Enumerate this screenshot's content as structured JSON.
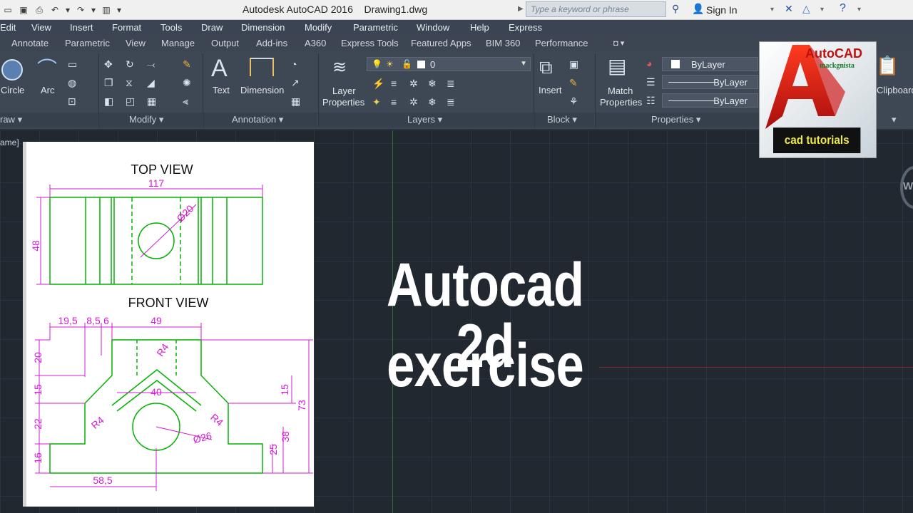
{
  "app": {
    "title": "Autodesk AutoCAD 2016",
    "document": "Drawing1.dwg",
    "search_placeholder": "Type a keyword or phrase",
    "sign_in": "Sign In"
  },
  "menu": [
    "Edit",
    "View",
    "Insert",
    "Format",
    "Tools",
    "Draw",
    "Dimension",
    "Modify",
    "Parametric",
    "Window",
    "Help",
    "Express"
  ],
  "tabs": [
    "Annotate",
    "Parametric",
    "View",
    "Manage",
    "Output",
    "Add-ins",
    "A360",
    "Express Tools",
    "Featured Apps",
    "BIM 360",
    "Performance"
  ],
  "ribbon": {
    "draw": {
      "title": "raw",
      "circle": "Circle",
      "arc": "Arc"
    },
    "modify": {
      "title": "Modify"
    },
    "annotation": {
      "title": "Annotation",
      "text": "Text",
      "dimension": "Dimension"
    },
    "layers": {
      "title": "Layers",
      "layer_props_1": "Layer",
      "layer_props_2": "Properties",
      "current_layer": "0"
    },
    "block": {
      "title": "Block",
      "insert": "Insert"
    },
    "properties": {
      "title": "Properties",
      "match_1": "Match",
      "match_2": "Properties",
      "color": "ByLayer",
      "linetype": "ByLayer",
      "lineweight": "ByLayer"
    },
    "clipboard": {
      "label": "Clipboard"
    }
  },
  "viewport_label": "ame]",
  "drawing": {
    "top_view_title": "TOP VIEW",
    "front_view_title": "FRONT VIEW",
    "top_dims": {
      "width": "117",
      "height": "48",
      "dia": "Ø20"
    },
    "front_dims": {
      "d195": "19,5",
      "d85": "8,5",
      "d6": "6",
      "d49": "49",
      "d40": "40",
      "d585": "58,5",
      "d20": "20",
      "d15a": "15",
      "d22": "22",
      "d16": "16",
      "d15b": "15",
      "d73": "73",
      "d38": "38",
      "d25": "25",
      "r4a": "R4",
      "r4b": "R4",
      "r4c": "R4",
      "dia26": "Ø26"
    }
  },
  "overlay": {
    "line1": "Autocad 2d",
    "line2": "exercise"
  },
  "logo": {
    "brand": "AutoCAD",
    "sub": "mackgnista",
    "caption": "cad tutorials"
  },
  "colors": {
    "drawing_green": "#00b300",
    "dimension_magenta": "#d41ad4",
    "menu_bg": "#3b4453",
    "canvas_bg": "#212830"
  }
}
